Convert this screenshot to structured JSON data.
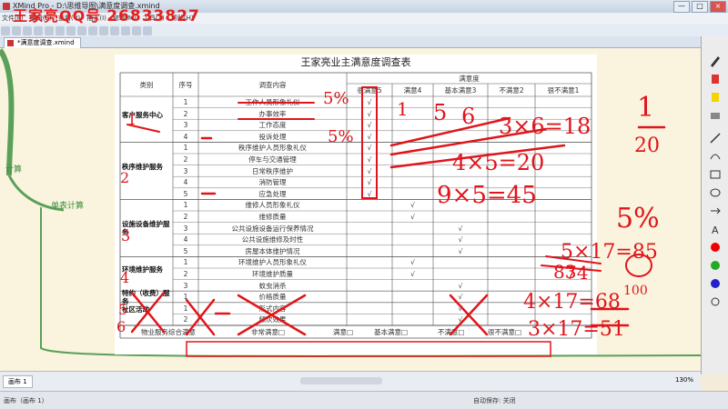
{
  "window": {
    "title": "XMind Pro - D:\\思维导图\\满意度调查.xmind",
    "buttons": [
      "—",
      "□",
      "×"
    ]
  },
  "watermark": {
    "text": "王家亮QQ号",
    "number": "26833827"
  },
  "menu": [
    "文件(F)",
    "编辑(E)",
    "查看(V)",
    "插入(I)",
    "修改(M)",
    "工具(T)",
    "帮助(H)"
  ],
  "tab": {
    "label": "*满意度调查.xmind"
  },
  "branches": [
    "计算",
    "单表计算"
  ],
  "survey": {
    "title": "王家亮业主满意度调查表",
    "headers": {
      "category": "类别",
      "index": "序号",
      "content": "调查内容",
      "satisfaction": "满意度"
    },
    "levels": [
      "很满意5",
      "满意4",
      "基本满意3",
      "不满意2",
      "很不满意1"
    ],
    "sections": [
      {
        "name": "客户服务中心",
        "items": [
          {
            "n": "1",
            "t": "工作人员形象礼仪"
          },
          {
            "n": "2",
            "t": "办事效率"
          },
          {
            "n": "3",
            "t": "工作态度"
          },
          {
            "n": "4",
            "t": "投诉处理"
          }
        ]
      },
      {
        "name": "秩序维护服务",
        "items": [
          {
            "n": "1",
            "t": "秩序维护人员形象礼仪"
          },
          {
            "n": "2",
            "t": "停车与交通管理"
          },
          {
            "n": "3",
            "t": "日常秩序维护"
          },
          {
            "n": "4",
            "t": "消防管理"
          },
          {
            "n": "5",
            "t": "应急处理"
          }
        ]
      },
      {
        "name": "设施设备维护服务",
        "items": [
          {
            "n": "1",
            "t": "维修人员形象礼仪"
          },
          {
            "n": "2",
            "t": "维修质量"
          },
          {
            "n": "3",
            "t": "公共设施设备运行保养情况"
          },
          {
            "n": "4",
            "t": "公共设施维修及时性"
          },
          {
            "n": "5",
            "t": "房屋本体维护情况"
          }
        ]
      },
      {
        "name": "环境维护服务",
        "items": [
          {
            "n": "1",
            "t": "环境维护人员形象礼仪"
          },
          {
            "n": "2",
            "t": "环境维护质量"
          },
          {
            "n": "3",
            "t": "蚊虫消杀"
          }
        ]
      },
      {
        "name": "特约（收费）服务",
        "items": [
          {
            "n": "1",
            "t": "价格质量"
          }
        ]
      },
      {
        "name": "社区活动",
        "items": [
          {
            "n": "1",
            "t": "形式内容"
          },
          {
            "n": "2",
            "t": "频次效果"
          }
        ]
      }
    ],
    "check": "√",
    "overall": {
      "label": "物业服务综合满意",
      "options": [
        "非常满意□",
        "满意□",
        "基本满意□",
        "不满意□",
        "很不满意□"
      ]
    }
  },
  "handwriting": [
    "5%",
    "5%",
    "1",
    "5",
    "6",
    "3×6=18",
    "4×5=20",
    "9×5=45",
    "1",
    "20",
    "5%",
    "5×17=85",
    "83",
    "74",
    "100",
    "4×17=68",
    "3×17=51",
    "1",
    "2",
    "3",
    "4",
    "5",
    "6"
  ],
  "sheet": {
    "label": "画布 1"
  },
  "status": {
    "left": "画布（画布 1）",
    "autosave": "自动保存: 关闭",
    "zoom": "130%"
  },
  "colors": {
    "annotation": "#e0141a",
    "branch": "#3a8f3a",
    "watermark": "#e32020"
  }
}
